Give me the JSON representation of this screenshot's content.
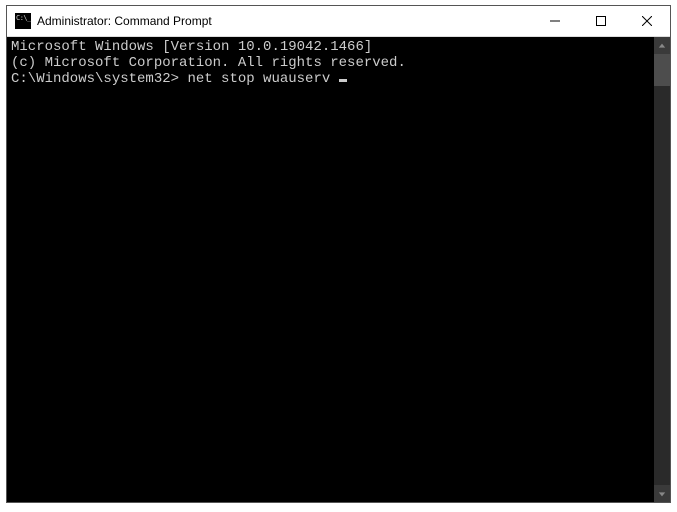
{
  "window": {
    "title": "Administrator: Command Prompt"
  },
  "terminal": {
    "line1": "Microsoft Windows [Version 10.0.19042.1466]",
    "line2": "(c) Microsoft Corporation. All rights reserved.",
    "blank": "",
    "prompt": "C:\\Windows\\system32>",
    "command": "net stop wuauserv"
  }
}
